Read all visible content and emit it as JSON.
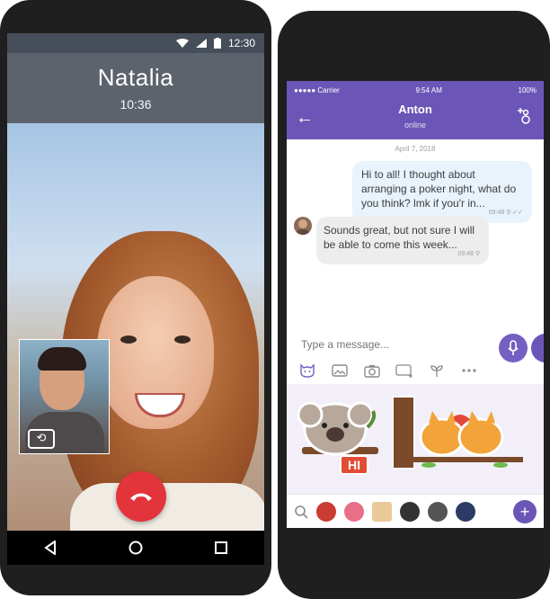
{
  "colors": {
    "viber_purple": "#6b56b7",
    "end_call_red": "#e3343c",
    "outgoing_bubble": "#e8f3fc",
    "incoming_bubble": "#ededed"
  },
  "left_phone": {
    "status_time": "12:30",
    "caller_name": "Natalia",
    "call_duration": "10:36",
    "icons": [
      "wifi-icon",
      "signal-icon",
      "battery-icon",
      "switch-camera-icon",
      "end-call-icon",
      "back-nav-icon",
      "home-nav-icon",
      "recents-nav-icon"
    ]
  },
  "right_phone": {
    "status": {
      "carrier": "●●●●● Carrier",
      "time": "9:54 AM",
      "battery": "100%"
    },
    "header": {
      "contact_name": "Anton",
      "contact_status": "online"
    },
    "chat": {
      "date": "April 7, 2018",
      "messages": [
        {
          "direction": "outgoing",
          "text": "Hi to all! I thought about arranging a poker night, what do you think? lmk if you'r in...",
          "time": "09:48"
        },
        {
          "direction": "incoming",
          "text": "Sounds great, but not sure I will be able to come this week...",
          "time": "09:48"
        }
      ]
    },
    "composer": {
      "placeholder": "Type a message...",
      "tools": [
        "sticker-icon",
        "gallery-icon",
        "camera-icon",
        "gif-icon",
        "doodle-icon",
        "more-icon"
      ]
    },
    "stickers": {
      "hi_label": "HI"
    }
  }
}
